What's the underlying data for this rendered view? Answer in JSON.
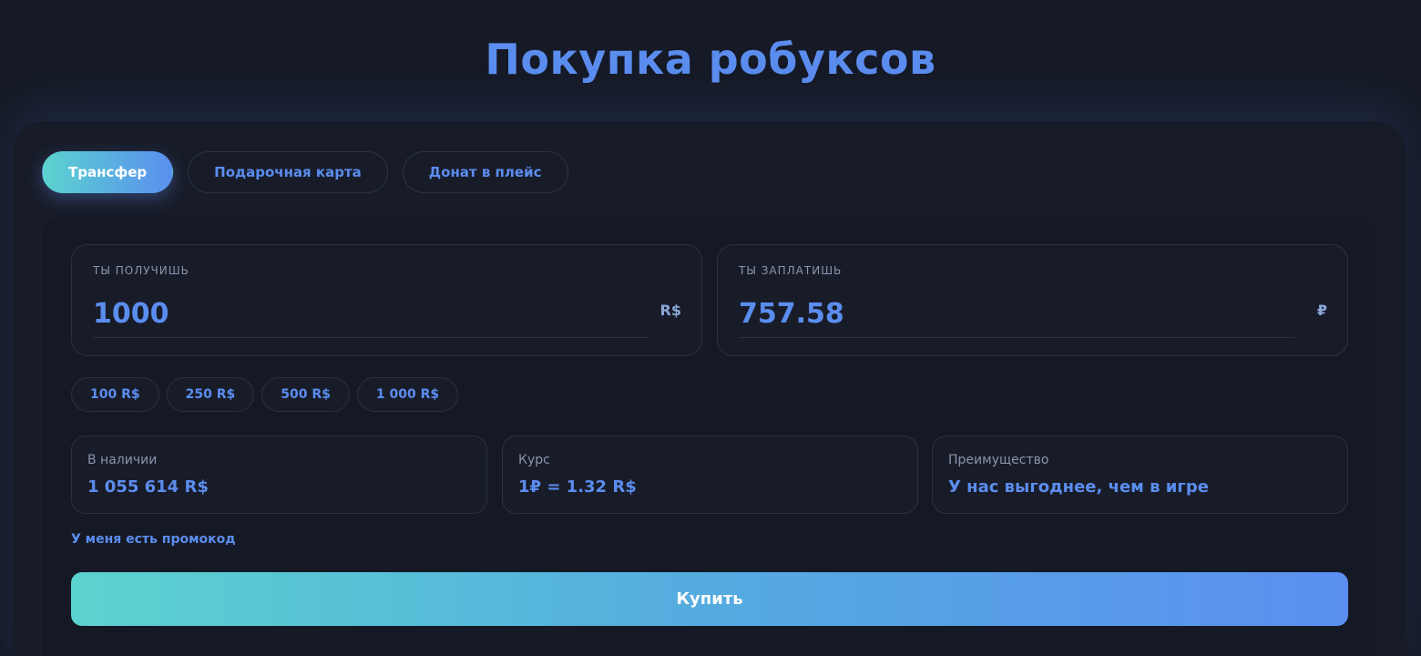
{
  "page": {
    "title": "Покупка робуксов"
  },
  "tabs": [
    {
      "label": "Трансфер",
      "active": true
    },
    {
      "label": "Подарочная карта",
      "active": false
    },
    {
      "label": "Донат в плейс",
      "active": false
    }
  ],
  "receive": {
    "label": "ТЫ ПОЛУЧИШЬ",
    "value": "1000",
    "unit": "R$"
  },
  "pay": {
    "label": "ТЫ ЗАПЛАТИШЬ",
    "value": "757.58",
    "unit": "₽"
  },
  "presets": [
    "100 R$",
    "250 R$",
    "500 R$",
    "1 000 R$"
  ],
  "info": {
    "stock": {
      "label": "В наличии",
      "value": "1 055 614 R$"
    },
    "rate": {
      "label": "Курс",
      "value": "1₽ = 1.32 R$"
    },
    "advantage": {
      "label": "Преимущество",
      "value": "У нас выгоднее, чем в игре"
    }
  },
  "promo_label": "У меня есть промокод",
  "buy_label": "Купить",
  "colors": {
    "accent": "#5b8def",
    "gradient_start": "#5bd3cf",
    "gradient_end": "#5a8ff0",
    "background": "#161a26"
  }
}
